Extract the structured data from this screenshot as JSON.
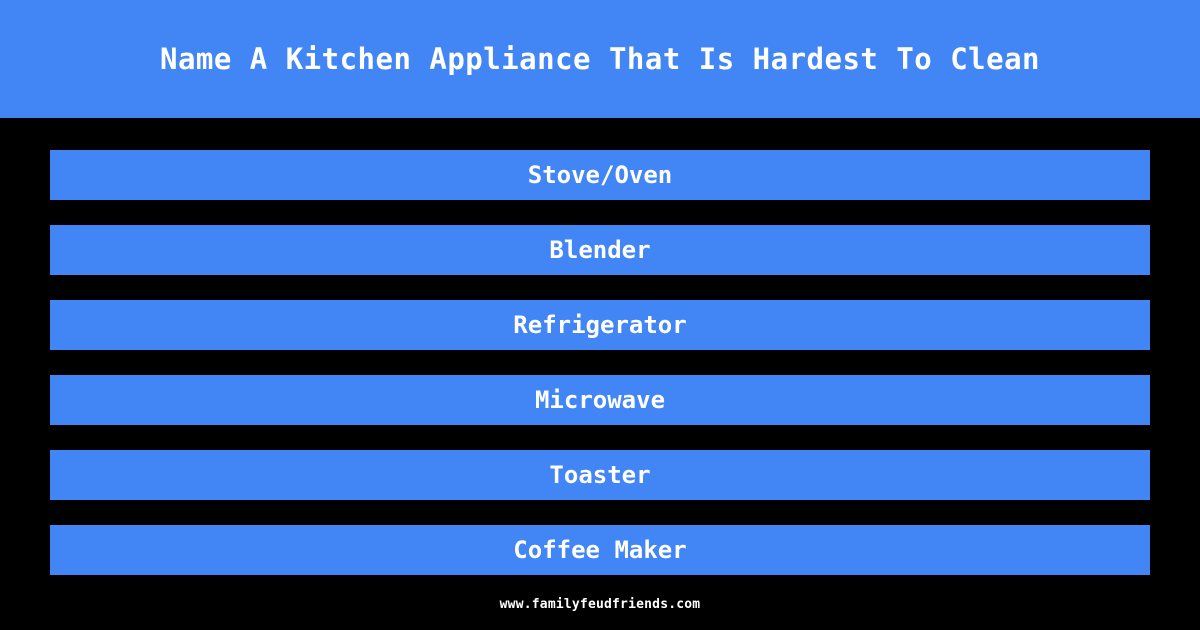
{
  "theme": {
    "background_color": "#000000",
    "accent_color": "#4285f4",
    "text_color": "#ffffff"
  },
  "header": {
    "title": "Name A Kitchen Appliance That Is Hardest To Clean"
  },
  "answers": [
    {
      "label": "Stove/Oven"
    },
    {
      "label": "Blender"
    },
    {
      "label": "Refrigerator"
    },
    {
      "label": "Microwave"
    },
    {
      "label": "Toaster"
    },
    {
      "label": "Coffee Maker"
    }
  ],
  "footer": {
    "url": "www.familyfeudfriends.com"
  }
}
